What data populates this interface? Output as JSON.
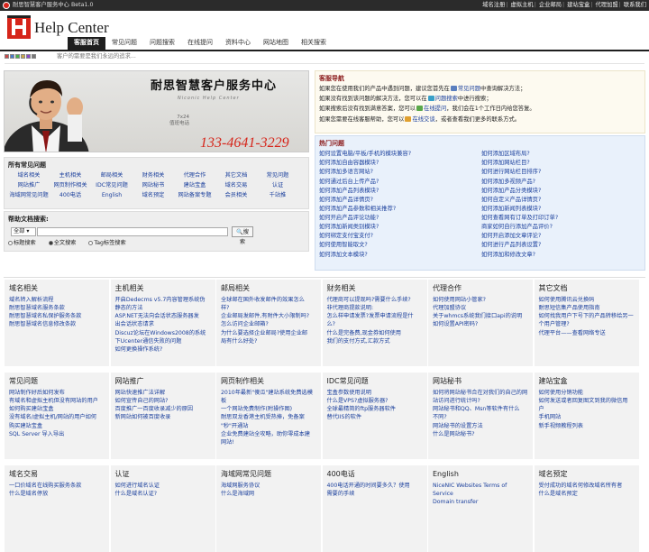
{
  "topbar": {
    "title": "耐思智慧客户服务中心 Beta1.0",
    "links": [
      "域名注册",
      "虚拟主机",
      "企业邮局",
      "建站宝盒",
      "代理加盟",
      "联系我们"
    ]
  },
  "header": {
    "brand": "Help Center",
    "nav": [
      "客服首页",
      "常见问题",
      "问题搜索",
      "在线提问",
      "资料中心",
      "网站地图",
      "相关搜索"
    ],
    "active_nav": "客服首页"
  },
  "notice": "客户的需要是我们永远的追求...",
  "banner": {
    "title": "耐思智慧客户服务中心",
    "subtitle": "Niconic Help Center",
    "hours": "7x24",
    "hotline_label": "值班电话",
    "phone": "133-4641-3229"
  },
  "service_nav": {
    "title": "客服导航",
    "lines": [
      {
        "pre": "如果您在使用我们的产品中遇到问题，建议您首先在",
        "link": "常见问题",
        "post": "中查询解决方法；"
      },
      {
        "pre": "如果没有找到该问题的解决方法，您可以在",
        "link": "问题搜索",
        "post": "中进行搜索；"
      },
      {
        "pre": "如果搜索后没有找到满意答案，您可以",
        "link": "在线提问",
        "post": "，我们会在1个工作日内给您答复。"
      },
      {
        "pre": "如果您需要在线客服帮助，您可以",
        "link": "在线交谈",
        "post": "，或者查看我们更多的联系方式。"
      }
    ]
  },
  "hot": {
    "title": "热门问题",
    "items": [
      "如何设置电脑/平板/手机的模块兼容?",
      "如何添加区域布局?",
      "如何添加自由容器模块?",
      "如何添加网站栏目?",
      "如何添加多语言网站?",
      "如何进行网站栏目排序?",
      "如何通过后台上传产品?",
      "如何添加多视频产品?",
      "如何添加产品列表模块?",
      "如何添加产品分类模块?",
      "如何添加产品详情页?",
      "如何自定义产品详情页?",
      "如何添加产品参数和相关推荐?",
      "如何添加新闻列表模块?",
      "如何开启产品评论功能?",
      "如何查看网有订单及打印订单?",
      "如何添加新闻类别模块?",
      "商家如何自行添加产品评价?",
      "如何绑定支付宝支付?",
      "如何开启添加文章评论?",
      "如何使用智能取文?",
      "如何进行产品列表设置?",
      "如何添加文本模块?",
      "如何添加和修改文章?"
    ]
  },
  "faq": {
    "title": "所有常见问题",
    "items": [
      "域名相关",
      "主机相关",
      "邮局相关",
      "财务相关",
      "代理合作",
      "其它文档",
      "常见问题",
      "网站推广",
      "网页制作相关",
      "IDC常见问题",
      "网站秘书",
      "建站宝盒",
      "域名交易",
      "认证",
      "海域网常见问题",
      "400电话",
      "English",
      "域名预定",
      "网站备案专题",
      "会员相关",
      "千站推"
    ]
  },
  "search": {
    "title": "帮助文档搜索:",
    "select_value": "全部",
    "button": "搜 索",
    "options": [
      "标题搜索",
      "全文搜索",
      "Tag标签搜索"
    ],
    "selected": "全文搜索"
  },
  "categories": [
    {
      "title": "域名相关",
      "items": [
        "域名转入解析流程",
        "耐思智慧域名服务条款",
        "耐思智慧域名私保护服务条款",
        "耐思智慧域名信息修改条款"
      ]
    },
    {
      "title": "主机相关",
      "items": [
        "开启Dedecms v5.7内容管理系统伪",
        "静态的方法",
        "ASP.NET无法向会话状态服务器发",
        "出会话状态请求",
        "Discuz论坛在Windows2008的系统",
        "下Ucenter通信失败的问题",
        "如何更换操作系统?"
      ]
    },
    {
      "title": "邮局相关",
      "items": [
        "全球邮在国外收发邮件的效果怎么",
        "样?",
        "企业邮局发邮件,有附件大小限制吗?",
        "怎么访问企业邮箱?",
        "为什么要选择企业邮局?使用企业邮",
        "局有什么好处?"
      ]
    },
    {
      "title": "财务相关",
      "items": [
        "代理商可以提现吗?需要什么手续?",
        "非代理商提款说明:",
        "怎么样申请发票?发票申请流程是什",
        "么?",
        "什么是完备费,现金券如何使用",
        "我们的支付方式,汇款方式"
      ]
    },
    {
      "title": "代理合作",
      "items": [
        "如何使用网站小管家?",
        "代理加盟协议",
        "关于whmcs系统我们接口api的说明",
        "如何设置API密码?"
      ]
    },
    {
      "title": "其它文档",
      "items": [
        "如何使用腾讯云兑换码",
        "耐思短信集产品使用指南",
        "如何找我用户下号下的产品转移给另一",
        "个用户管理?",
        "代理平台——查看网络专送"
      ]
    },
    {
      "title": "常见问题",
      "items": [
        "网站制作好后如何发布",
        "有域名和虚拟主机但没有网站的用户",
        "如何购买建站宝盒",
        "没有域名/虚拟主机/网站的用户如何",
        "购买建站宝盒",
        "SQL Server 导入导出"
      ]
    },
    {
      "title": "网站推广",
      "items": [
        "网站快速推广法详解",
        "如何宣传自己的网站?",
        "百度推广一百度收录减少的原因",
        "新网站如何被百度收录"
      ]
    },
    {
      "title": "网页制作相关",
      "items": [
        "2010年最新\"傻瓜\"建站系统免费选模板",
        "一个网站免费制作(附操作图)",
        "耐思双龙香港主机受热捧，免备案",
        "\"秒\"开通站",
        "企业免费建站全攻略，助你零成本建",
        "网站!"
      ]
    },
    {
      "title": "IDC常见问题",
      "items": [
        "宝盒参数使用说明",
        "什么是VPS?虚拟服务器?",
        "全球最精简的ftp服务器软件",
        "替代IIS的软件"
      ]
    },
    {
      "title": "网站秘书",
      "items": [
        "如何将网站秘书合在对我们的自己的网",
        "站访问进行统计吗?",
        "网站秘书和QQ、Msn等软件有什么",
        "不同?",
        "网站秘书的设置方法",
        "什么是网站秘书?"
      ]
    },
    {
      "title": "建站宝盒",
      "items": [
        "如何使用分销功能",
        "如何发送或者回复图文到我的微信用",
        "户",
        "手机网站",
        "新手视频教程列表"
      ]
    },
    {
      "title": "域名交易",
      "items": [
        "一口价域名在线购买服务条款",
        "什么是域名停放"
      ]
    },
    {
      "title": "认证",
      "items": [
        "如何进行域名认证",
        "什么是域名认证?"
      ]
    },
    {
      "title": "海域网常见问题",
      "items": [
        "海域网服务协议",
        "什么是海域网"
      ]
    },
    {
      "title": "400电话",
      "items": [
        "400电话开通的时间要多久？使用",
        "需要的手续"
      ]
    },
    {
      "title": "English",
      "items": [
        "NiceNIC Websites Terms of Service",
        "Domain transfer"
      ]
    },
    {
      "title": "域名预定",
      "items": [
        "受付成功的域名何修改域名所有者",
        "什么是域名预定"
      ]
    }
  ],
  "colors": {
    "accent_red": "#d6251a",
    "link_blue": "#1a3f9c",
    "dark_bar": "#1e1e1e"
  }
}
